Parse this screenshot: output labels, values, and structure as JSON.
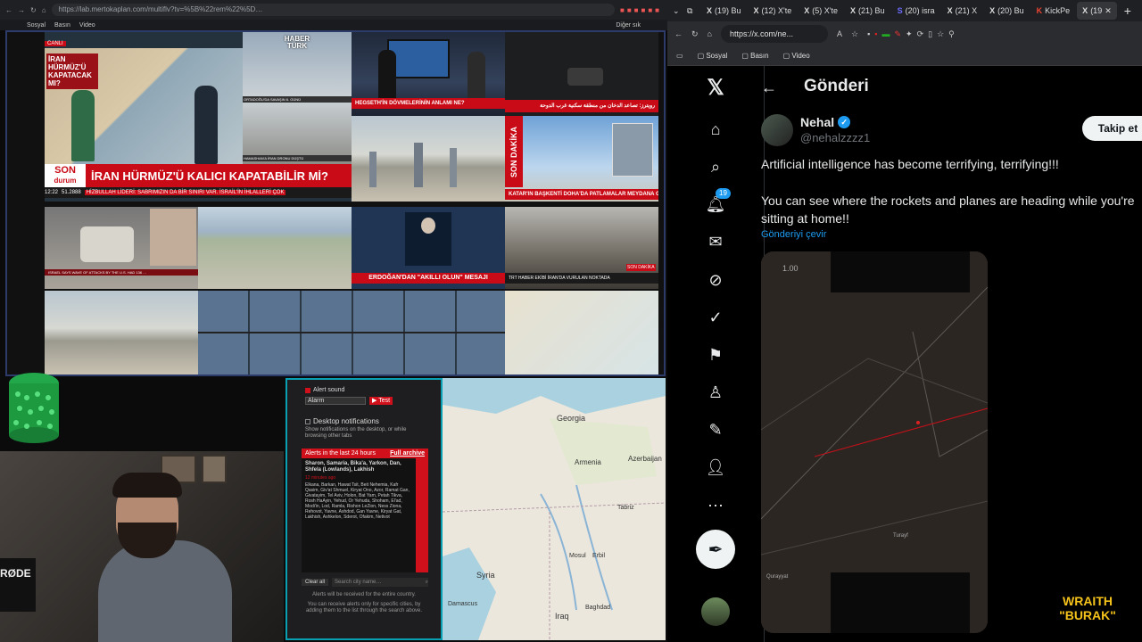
{
  "left_browser": {
    "url": "https://lab.mertokaplan.com/multiflv?tv=%5B%22rem%22%5D…",
    "bookmarks": [
      "Sosyal",
      "Basın",
      "Video"
    ],
    "more_bookmarks": "Diğer sık"
  },
  "news": {
    "tile1_channel": "CANLI",
    "tile1_headline_map": "İRAN HÜRMÜZ'Ü KAPATACAK MI?",
    "brand_top": "HABER",
    "brand_bottom": "TÜRK",
    "son_durum_top": "SON",
    "son_durum_bottom": "durum",
    "main_headline": "İRAN HÜRMÜZ'Ü KALICI KAPATABİLİR Mİ?",
    "ticker": "HİZBULLAH LİDERİ: SABRIMIZIN DA BİR SINIRI VAR. İSRAİL'İN İHLALLERİ ÇOK",
    "ticker_time": "12:22",
    "ticker_index": "51.2888",
    "side_caption1": "ORTADOĞU'DA SAVAŞIN 6. GÜNÜ",
    "side_caption2": "HAMASHAN'A İRAN DRONU DÜŞTÜ",
    "tile2_caption": "HEGSETH'İN DÖVMELERİNİN ANLAMI NE?",
    "tile3_caption": "رويترز: تصاعد الدخان من منطقة سكنية غرب الدوحة",
    "tile4_flash_top": "SON",
    "tile4_flash_bottom": "DAKİKA",
    "tile4_caption": "KATAR'IN BAŞKENTİ DOHA'DA PATLAMALAR MEYDANA GELDİ",
    "tile5_caption": "ERDOĞAN'DAN \"AKILLI OLUN\" MESAJI",
    "tile6_caption": "TRT HABER EKİBİ İRAN'DA VURULAN NOKTADA",
    "tile6_flash": "SON DAKİKA",
    "aljazeera_caption": "ISRAEL SAYS WAVE OF ATTACKS BY THE U.S. HAD 136 …"
  },
  "alerts": {
    "alert_sound_label": "Alert sound",
    "alarm_select": "Alarm",
    "test_button": "▶ Test",
    "desktop_notif_label": "Desktop notifications",
    "desktop_notif_desc": "Show notifications on the desktop, or while browsing other tabs",
    "header": "Alerts in the last 24 hours",
    "archive_link": "Full archive",
    "region": "Sharon, Samaria, Bika'a, Yarkon, Dan, Shfela (Lowlands), Lakhish",
    "time": "12 minutes ago",
    "cities": "Elkana, Barkan, Hawat Tsit, Beit Nehemia, Kafr Qasim, Giv'at Shmuel, Kiryat Ono, Azor, Ramat Gan, Givatayim, Tel Aviv, Holon, Bat Yam, Petah Tikva, Rosh HaAyin, Yehud, Or Yehuda, Shoham, El'ad, Modi'in, Lod, Ramla, Rishon LeZion, Ness Ziona, Rehovot, Yavne, Ashdod, Gan Yavne, Kiryat Gat, Lakhish, Ashkelon, Sderot, Ofakim, Netivot",
    "clear_all": "Clear all",
    "search_placeholder": "Search city name…",
    "footer1": "Alerts will be received for the entire country.",
    "footer2": "You can receive alerts only for specific cities, by adding them to the list through the search above."
  },
  "map": {
    "labels": [
      "Georgia",
      "Armenia",
      "Azerbaijan",
      "Tabriz",
      "Mosul",
      "Erbil",
      "Syria",
      "Damascus",
      "Iraq",
      "Baghdad"
    ]
  },
  "right_browser": {
    "tabs": [
      {
        "icon": "X",
        "label": "(19) Bu"
      },
      {
        "icon": "X",
        "label": "(12) X'te"
      },
      {
        "icon": "X",
        "label": "(5) X'te"
      },
      {
        "icon": "X",
        "label": "(21) Bu"
      },
      {
        "icon": "S",
        "label": "(20) isra"
      },
      {
        "icon": "X",
        "label": "(21) X"
      },
      {
        "icon": "X",
        "label": "(20) Bu"
      },
      {
        "icon": "K",
        "label": "KickPe"
      },
      {
        "icon": "X",
        "label": "(19"
      }
    ],
    "url": "https://x.com/ne...",
    "bookmarks": [
      "Sosyal",
      "Basın",
      "Video"
    ]
  },
  "x": {
    "page_title": "Gönderi",
    "notif_count": "19",
    "author_name": "Nehal",
    "author_handle": "@nehalzzzz1",
    "follow_label": "Takip et",
    "tweet_line1": "Artificial intelligence has become terrifying, terrifying!!!",
    "tweet_line2": "You can see where the rockets and planes are heading while you're sitting at home!!",
    "translate_link": "Gönderiyi çevir",
    "video_speed": "1.00",
    "video_place": "Turayf",
    "video_place2": "Qurayyat"
  },
  "watermark": {
    "line1": "WRAITH",
    "line2": "\"BURAK\""
  },
  "colors": {
    "x_blue": "#1d9bf0",
    "news_red": "#c80b16",
    "alert_red": "#d0101a",
    "panel_border": "#0aa0b4"
  }
}
